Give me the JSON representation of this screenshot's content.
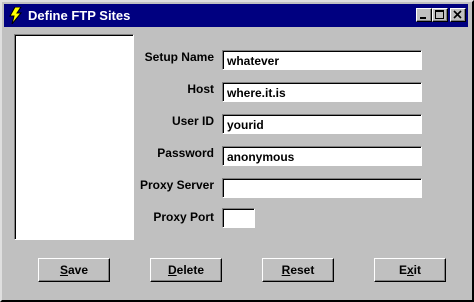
{
  "window": {
    "title": "Define FTP Sites"
  },
  "titlebar_buttons": {
    "minimize": "minimize-icon",
    "maximize": "maximize-icon",
    "close": "close-icon"
  },
  "form": {
    "setup_name": {
      "label": "Setup Name",
      "value": "whatever"
    },
    "host": {
      "label": "Host",
      "value": "where.it.is"
    },
    "user_id": {
      "label": "User ID",
      "value": "yourid"
    },
    "password": {
      "label": "Password",
      "value": "anonymous"
    },
    "proxy_server": {
      "label": "Proxy Server",
      "value": ""
    },
    "proxy_port": {
      "label": "Proxy Port",
      "value": ""
    }
  },
  "buttons": {
    "save": {
      "accel": "S",
      "rest": "ave"
    },
    "delete": {
      "accel": "D",
      "rest": "elete"
    },
    "reset": {
      "accel": "R",
      "rest": "eset"
    },
    "exit": {
      "pre": "E",
      "accel": "x",
      "rest": "it"
    }
  },
  "colors": {
    "titlebar": "#000080",
    "face": "#c0c0c0"
  }
}
